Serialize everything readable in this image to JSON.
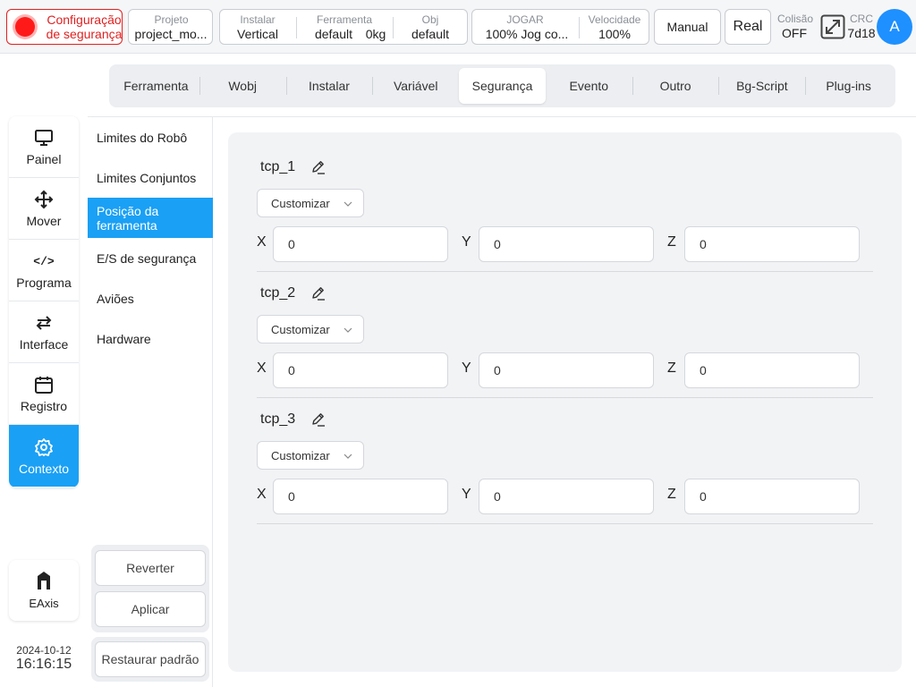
{
  "topbar": {
    "safety_config_line1": "Configuração",
    "safety_config_line2": "de segurança",
    "project": {
      "label": "Projeto",
      "value": "project_mo..."
    },
    "install": {
      "label": "Instalar",
      "value": "Vertical"
    },
    "tool": {
      "label": "Ferramenta",
      "value": "default",
      "mass": "0kg"
    },
    "obj": {
      "label": "Obj",
      "value": "default"
    },
    "jog": {
      "label": "JOGAR",
      "value": "100%  Jog co..."
    },
    "speed": {
      "label": "Velocidade",
      "value": "100%"
    },
    "mode_button": "Manual",
    "real_button": "Real",
    "collision": {
      "label": "Colisão",
      "value": "OFF"
    },
    "crc": {
      "label": "CRC",
      "value": "7d18"
    },
    "avatar": "A",
    "expand_icon": "expand-icon"
  },
  "leftnav": {
    "items": [
      {
        "label": "Painel",
        "icon": "monitor-icon"
      },
      {
        "label": "Mover",
        "icon": "move-arrows-icon"
      },
      {
        "label": "Programa",
        "icon": "code-icon"
      },
      {
        "label": "Interface",
        "icon": "swap-icon"
      },
      {
        "label": "Registro",
        "icon": "calendar-icon"
      },
      {
        "label": "Contexto",
        "icon": "gear-icon",
        "active": true
      }
    ],
    "eaxis_label": "EAxis",
    "date": "2024-10-12",
    "time": "16:16:15"
  },
  "tabs": [
    "Ferramenta",
    "Wobj",
    "Instalar",
    "Variável",
    "Segurança",
    "Evento",
    "Outro",
    "Bg-Script",
    "Plug-ins"
  ],
  "active_tab": "Segurança",
  "submenu": {
    "items": [
      "Limites do Robô",
      "Limites Conjuntos",
      "Posição da ferramenta",
      "E/S de segurança",
      "Aviões",
      "Hardware"
    ],
    "active": "Posição da ferramenta"
  },
  "actions": {
    "revert": "Reverter",
    "apply": "Aplicar",
    "restore": "Restaurar padrão"
  },
  "tcps": [
    {
      "name": "tcp_1",
      "mode": "Customizar",
      "x": "0",
      "y": "0",
      "z": "0"
    },
    {
      "name": "tcp_2",
      "mode": "Customizar",
      "x": "0",
      "y": "0",
      "z": "0"
    },
    {
      "name": "tcp_3",
      "mode": "Customizar",
      "x": "0",
      "y": "0",
      "z": "0"
    }
  ],
  "axis_labels": {
    "x": "X",
    "y": "Y",
    "z": "Z"
  },
  "colors": {
    "accent": "#1aa0f5",
    "danger": "#e02020",
    "avatar": "#1e90ff"
  }
}
